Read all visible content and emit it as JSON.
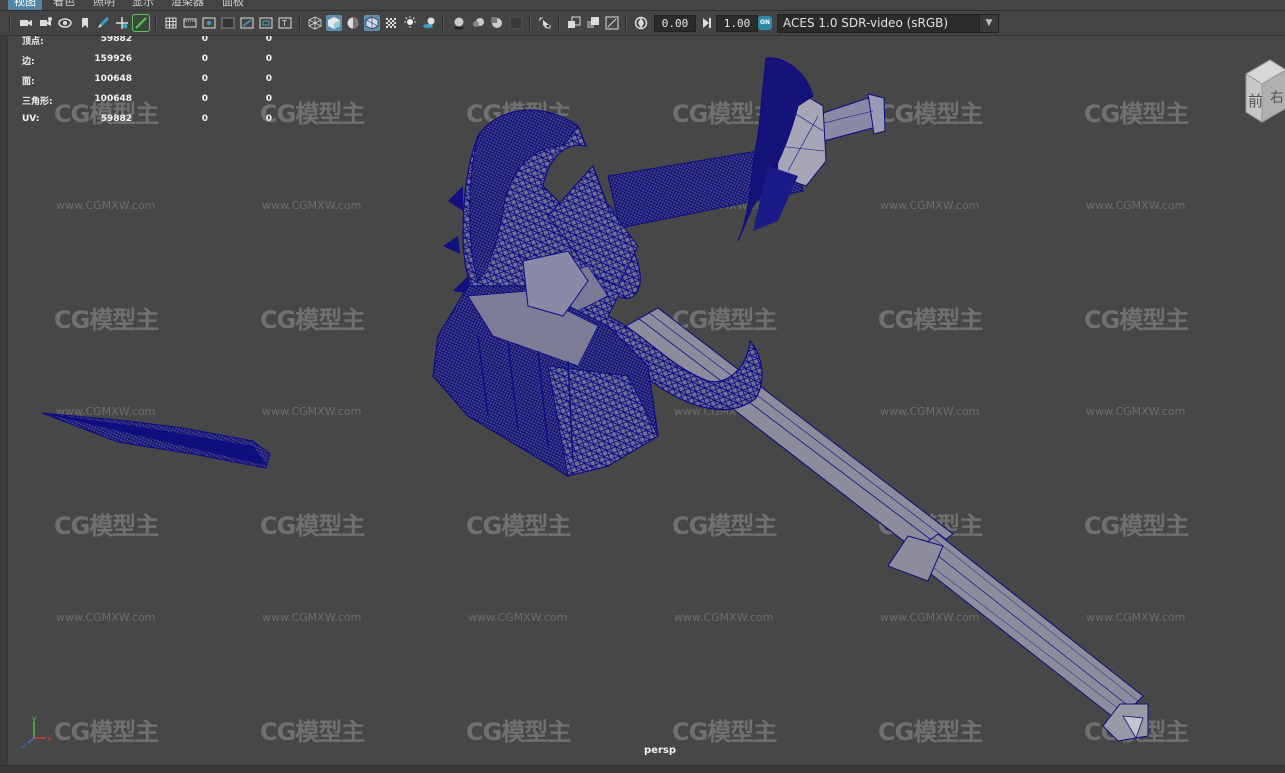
{
  "menu": {
    "items": [
      "视图",
      "着色",
      "照明",
      "显示",
      "渲染器",
      "面板"
    ]
  },
  "toolbar": {
    "exposure_value": "0.00",
    "gamma_value": "1.00",
    "color_mgmt_badge": "ON",
    "color_space": "ACES 1.0 SDR-video (sRGB)"
  },
  "hud": {
    "rows": [
      {
        "label": "顶点:",
        "c1": "59882",
        "c2": "0",
        "c3": "0"
      },
      {
        "label": "边:",
        "c1": "159926",
        "c2": "0",
        "c3": "0"
      },
      {
        "label": "面:",
        "c1": "100648",
        "c2": "0",
        "c3": "0"
      },
      {
        "label": "三角形:",
        "c1": "100648",
        "c2": "0",
        "c3": "0"
      },
      {
        "label": "UV:",
        "c1": "59882",
        "c2": "0",
        "c3": "0"
      }
    ]
  },
  "viewcube": {
    "front": "前",
    "right": "右"
  },
  "axis": {
    "y": "y",
    "x": "x",
    "z": "z"
  },
  "viewport": {
    "camera": "persp"
  },
  "watermark": {
    "logo": "CG模型主",
    "url": "www.CGMXW.com"
  },
  "colors": {
    "background": "#474747",
    "wireframe": "#0c0c84",
    "mesh_fill": "#8a8aa0",
    "active_menu": "#5285a6",
    "toggle_on": "#5d8fb0"
  }
}
